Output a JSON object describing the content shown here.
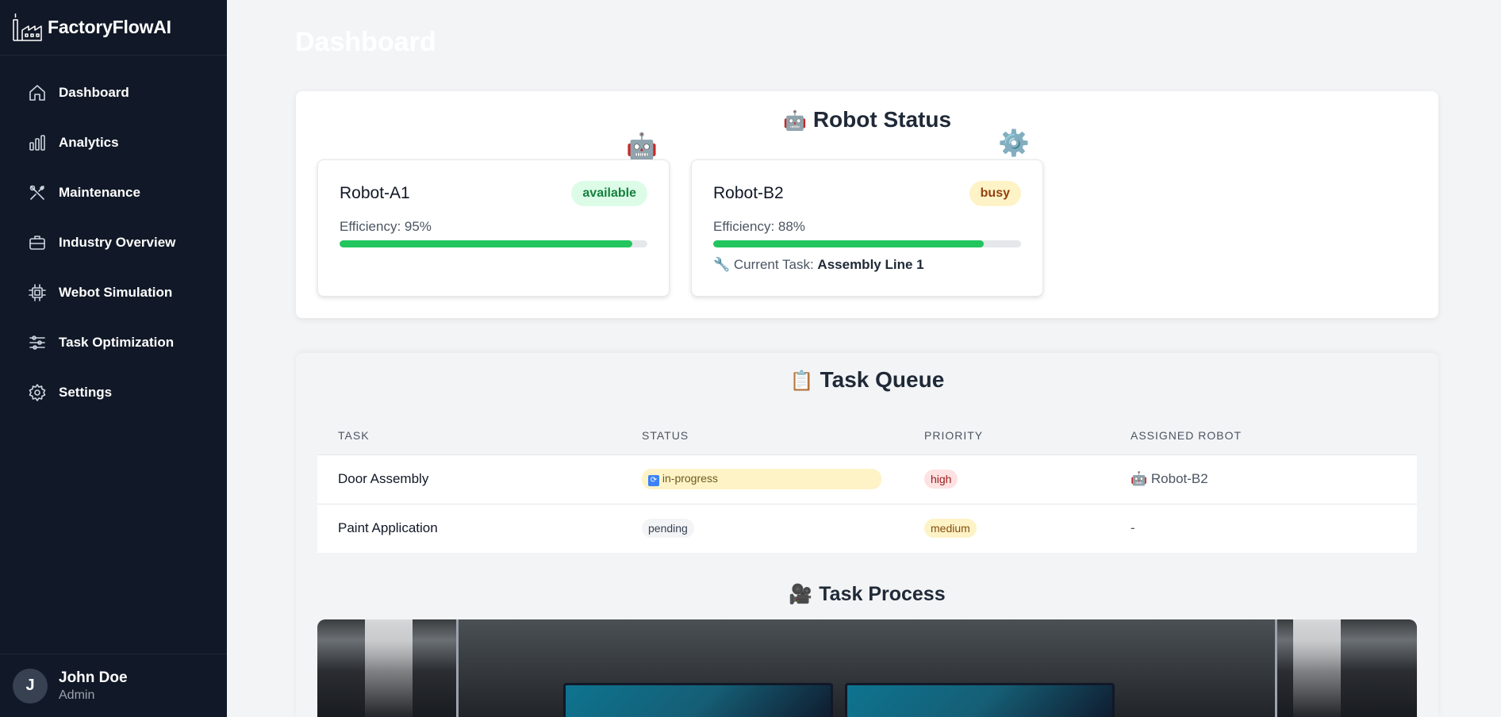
{
  "app": {
    "name": "FactoryFlowAI"
  },
  "sidebar": {
    "items": [
      {
        "label": "Dashboard",
        "icon": "home-icon"
      },
      {
        "label": "Analytics",
        "icon": "bar-chart-icon"
      },
      {
        "label": "Maintenance",
        "icon": "tools-icon"
      },
      {
        "label": "Industry Overview",
        "icon": "briefcase-icon"
      },
      {
        "label": "Webot Simulation",
        "icon": "cpu-icon"
      },
      {
        "label": "Task Optimization",
        "icon": "sliders-icon"
      },
      {
        "label": "Settings",
        "icon": "gear-icon"
      }
    ],
    "user": {
      "initial": "J",
      "name": "John Doe",
      "role": "Admin"
    }
  },
  "page": {
    "title": "Dashboard"
  },
  "robot_status": {
    "title": "Robot Status",
    "emoji": "🤖",
    "robots": [
      {
        "name": "Robot-A1",
        "status": "available",
        "efficiency_label": "Efficiency: 95%",
        "efficiency": 95,
        "current_task_label": "",
        "current_task": ""
      },
      {
        "name": "Robot-B2",
        "status": "busy",
        "efficiency_label": "Efficiency: 88%",
        "efficiency": 88,
        "current_task_label": "Current Task:",
        "current_task": "Assembly Line 1"
      }
    ]
  },
  "task_queue": {
    "title": "Task Queue",
    "emoji": "📋",
    "columns": [
      "TASK",
      "STATUS",
      "PRIORITY",
      "ASSIGNED ROBOT"
    ],
    "rows": [
      {
        "task": "Door Assembly",
        "status": "in-progress",
        "priority": "high",
        "assigned": "Robot-B2"
      },
      {
        "task": "Paint Application",
        "status": "pending",
        "priority": "medium",
        "assigned": "-"
      }
    ]
  },
  "task_process": {
    "title": "Task Process",
    "emoji": "🎥"
  },
  "colors": {
    "sidebar_bg": "#111827",
    "accent_green": "#22c55e",
    "page_bg": "#f3f4f6"
  }
}
